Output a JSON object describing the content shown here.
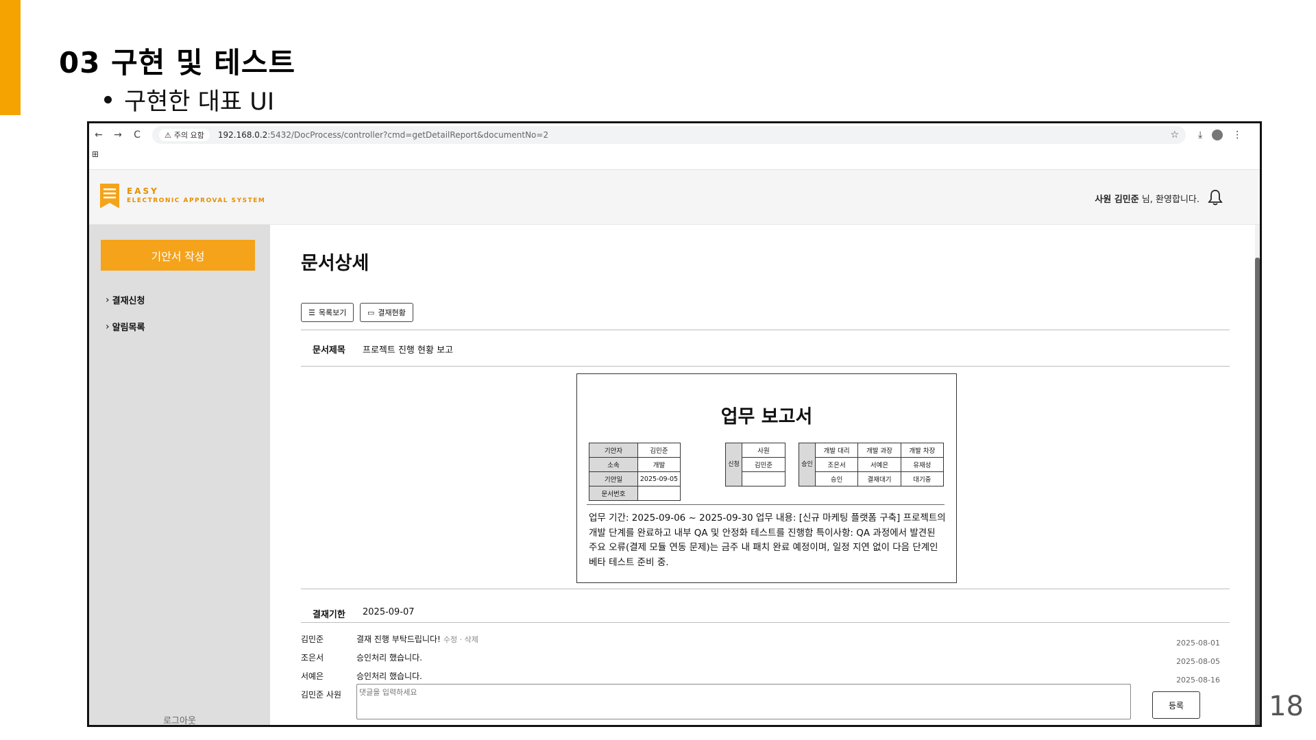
{
  "slide": {
    "title": "03  구현 및 테스트",
    "bullet": "구현한 대표 UI",
    "page_number": "18",
    "accent_color": "#f5a300"
  },
  "browser": {
    "nav": {
      "back_icon": "←",
      "forward_icon": "→",
      "reload_icon": "C"
    },
    "warning": "주의 요함",
    "url_host": "192.168.0.2",
    "url_path": ":5432/DocProcess/controller?cmd=getDetailReport&documentNo=2",
    "apps_icon": "⊞"
  },
  "app": {
    "logo_line1": "EASY",
    "logo_line2": "ELECTRONIC APPROVAL SYSTEM",
    "welcome_user": "사원 김민준",
    "welcome_suffix": " 님, 환영합니다.",
    "brand_color": "#f5a31a"
  },
  "sidebar": {
    "compose_label": "기안서 작성",
    "items": [
      {
        "label": "결재신청"
      },
      {
        "label": "알림목록"
      }
    ],
    "logout_label": "로그아웃"
  },
  "main": {
    "page_title": "문서상세",
    "list_button": "목록보기",
    "status_button": "결재현황",
    "doc_title_label": "문서제목",
    "doc_title_value": "프로젝트 진행 현황 보고",
    "deadline_label": "결재기한",
    "deadline_value": "2025-09-07"
  },
  "report": {
    "title": "업무 보고서",
    "info": {
      "drafter_label": "기안자",
      "drafter_value": "김민준",
      "dept_label": "소속",
      "dept_value": "개발",
      "date_label": "기안일",
      "date_value": "2025-09-05",
      "docno_label": "문서번호",
      "docno_value": ""
    },
    "request": {
      "side_label": "신청",
      "rank": "사원",
      "name": "김민준",
      "status": ""
    },
    "approval": {
      "side_label": "승인",
      "ranks": [
        "개발 대리",
        "개발 과장",
        "개발 차장"
      ],
      "names": [
        "조은서",
        "서예은",
        "유재성"
      ],
      "statuses": [
        "승인",
        "결재대기",
        "대기중"
      ]
    },
    "body": "업무 기간: 2025-09-06 ~ 2025-09-30 업무 내용: [신규 마케팅 플랫폼 구축] 프로젝트의 개발 단계를 완료하고 내부 QA 및 안정화 테스트를 진행함 특이사항: QA 과정에서 발견된 주요 오류(결제 모듈 연동 문제)는 금주 내 패치 완료 예정이며, 일정 지연 없이 다음 단계인 베타 테스트 준비 중."
  },
  "comments": [
    {
      "name": "김민준",
      "text": "결재 진행 부탁드립니다!",
      "actions": "수정 · 삭제",
      "date": "2025-08-01"
    },
    {
      "name": "조은서",
      "text": "승인처리 했습니다.",
      "actions": "",
      "date": "2025-08-05"
    },
    {
      "name": "서예은",
      "text": "승인처리 했습니다.",
      "actions": "",
      "date": "2025-08-16"
    }
  ],
  "comment_form": {
    "author": "김민준 사원",
    "placeholder": "댓글을 입력하세요",
    "submit_label": "등록"
  }
}
